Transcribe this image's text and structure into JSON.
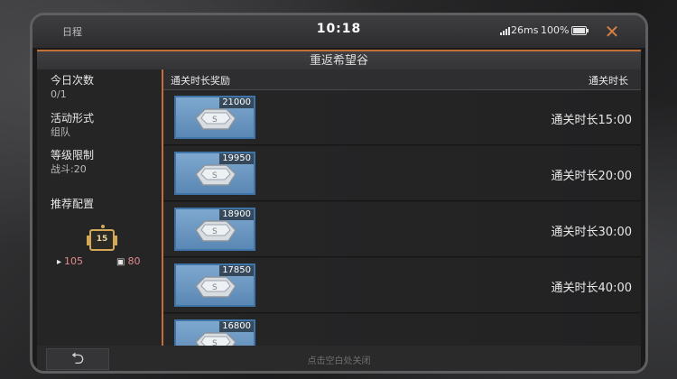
{
  "status_bar": {
    "schedule": "日程",
    "time": "10:18",
    "ping": "26ms",
    "battery": "100%"
  },
  "dialog": {
    "title": "重返希望谷",
    "close_icon": "close-x",
    "accent_color": "#c46f3a"
  },
  "info": {
    "daily_count_label": "今日次数",
    "daily_count_value": "0/1",
    "mode_label": "活动形式",
    "mode_value": "组队",
    "level_label": "等级限制",
    "level_value": "战斗:20",
    "recommend_label": "推荐配置",
    "badge_level": "15",
    "attack": "105",
    "defense": "80"
  },
  "table": {
    "reward_header": "通关时长奖励",
    "time_header": "通关时长",
    "rows": [
      {
        "quantity": "21000",
        "time": "通关时长15:00"
      },
      {
        "quantity": "19950",
        "time": "通关时长20:00"
      },
      {
        "quantity": "18900",
        "time": "通关时长30:00"
      },
      {
        "quantity": "17850",
        "time": "通关时长40:00"
      },
      {
        "quantity": "16800",
        "time": ""
      }
    ]
  },
  "footer": {
    "back_icon": "back-arrow",
    "hint": "点击空白处关闭"
  }
}
